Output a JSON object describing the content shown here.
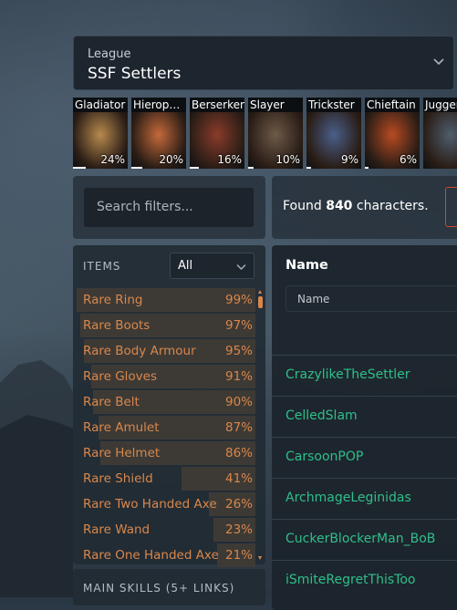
{
  "league": {
    "label": "League",
    "value": "SSF Settlers"
  },
  "classes": [
    {
      "name": "Gladiator",
      "percent": "24%",
      "share": 0.24,
      "tint": "#b78a4e"
    },
    {
      "name": "Hierop…",
      "percent": "20%",
      "share": 0.2,
      "tint": "#c4693a"
    },
    {
      "name": "Berserker",
      "percent": "16%",
      "share": 0.16,
      "tint": "#8a3b2a"
    },
    {
      "name": "Slayer",
      "percent": "10%",
      "share": 0.1,
      "tint": "#6d5a48"
    },
    {
      "name": "Trickster",
      "percent": "9%",
      "share": 0.09,
      "tint": "#4a5f8a"
    },
    {
      "name": "Chieftain",
      "percent": "6%",
      "share": 0.06,
      "tint": "#b84a22"
    },
    {
      "name": "Juggern",
      "percent": "",
      "share": 0,
      "tint": "#4f5e6e"
    }
  ],
  "search": {
    "placeholder": "Search filters..."
  },
  "found": {
    "prefix": "Found ",
    "count": "840",
    "suffix": " characters."
  },
  "items": {
    "header": "ITEMS",
    "filter_value": "All",
    "rows": [
      {
        "name": "Rare Ring",
        "percent": "99%",
        "share": 0.99
      },
      {
        "name": "Rare Boots",
        "percent": "97%",
        "share": 0.97
      },
      {
        "name": "Rare Body Armour",
        "percent": "95%",
        "share": 0.95
      },
      {
        "name": "Rare Gloves",
        "percent": "91%",
        "share": 0.91
      },
      {
        "name": "Rare Belt",
        "percent": "90%",
        "share": 0.9
      },
      {
        "name": "Rare Amulet",
        "percent": "87%",
        "share": 0.87
      },
      {
        "name": "Rare Helmet",
        "percent": "86%",
        "share": 0.86
      },
      {
        "name": "Rare Shield",
        "percent": "41%",
        "share": 0.41
      },
      {
        "name": "Rare Two Handed Axe",
        "percent": "26%",
        "share": 0.26
      },
      {
        "name": "Rare Wand",
        "percent": "23%",
        "share": 0.23
      },
      {
        "name": "Rare One Handed Axe",
        "percent": "21%",
        "share": 0.21
      }
    ]
  },
  "skills": {
    "header": "MAIN SKILLS (5+ LINKS)"
  },
  "table": {
    "column": "Name",
    "filter_placeholder": "Name",
    "rows": [
      "CrazylikeTheSettler",
      "CelledSlam",
      "CarsoonPOP",
      "ArchmageLeginidas",
      "CuckerBlockerMan_BoB",
      "iSmiteRegretThisToo"
    ]
  },
  "colors": {
    "accent": "#d9874a",
    "link": "#2fbf8a",
    "danger": "#d04a2a"
  }
}
